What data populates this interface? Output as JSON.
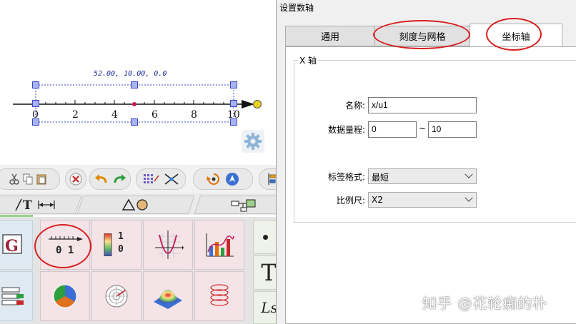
{
  "canvas": {
    "coordinate_readout": "52.00, 10.00, 0.0",
    "tick_labels": [
      "0",
      "2",
      "4",
      "6",
      "8",
      "10"
    ]
  },
  "grid": {
    "numberline_icon_text": "0 1",
    "colorbar_icon_text": [
      "1",
      "0"
    ],
    "side_letters": [
      "T",
      "Ls"
    ]
  },
  "dialog": {
    "title": "设置数轴",
    "tabs": [
      "通用",
      "刻度与网格",
      "坐标轴"
    ],
    "active_tab": "坐标轴",
    "group_title": "X 轴",
    "name_label": "名称:",
    "name_value": "x/u1",
    "range_label": "数据量程:",
    "range_min": "0",
    "range_sep": "~",
    "range_max": "10",
    "label_format_label": "标签格式:",
    "label_format_value": "最短",
    "scale_label": "比例尺:",
    "scale_value": "X2"
  },
  "watermark": "知乎 @花轮痴的朴",
  "colors": {
    "annotation_red": "#d81e1e",
    "handle_fill": "#a9b3f0",
    "handle_border": "#3a46c8",
    "endpoint_yellow": "#e8d21c"
  }
}
